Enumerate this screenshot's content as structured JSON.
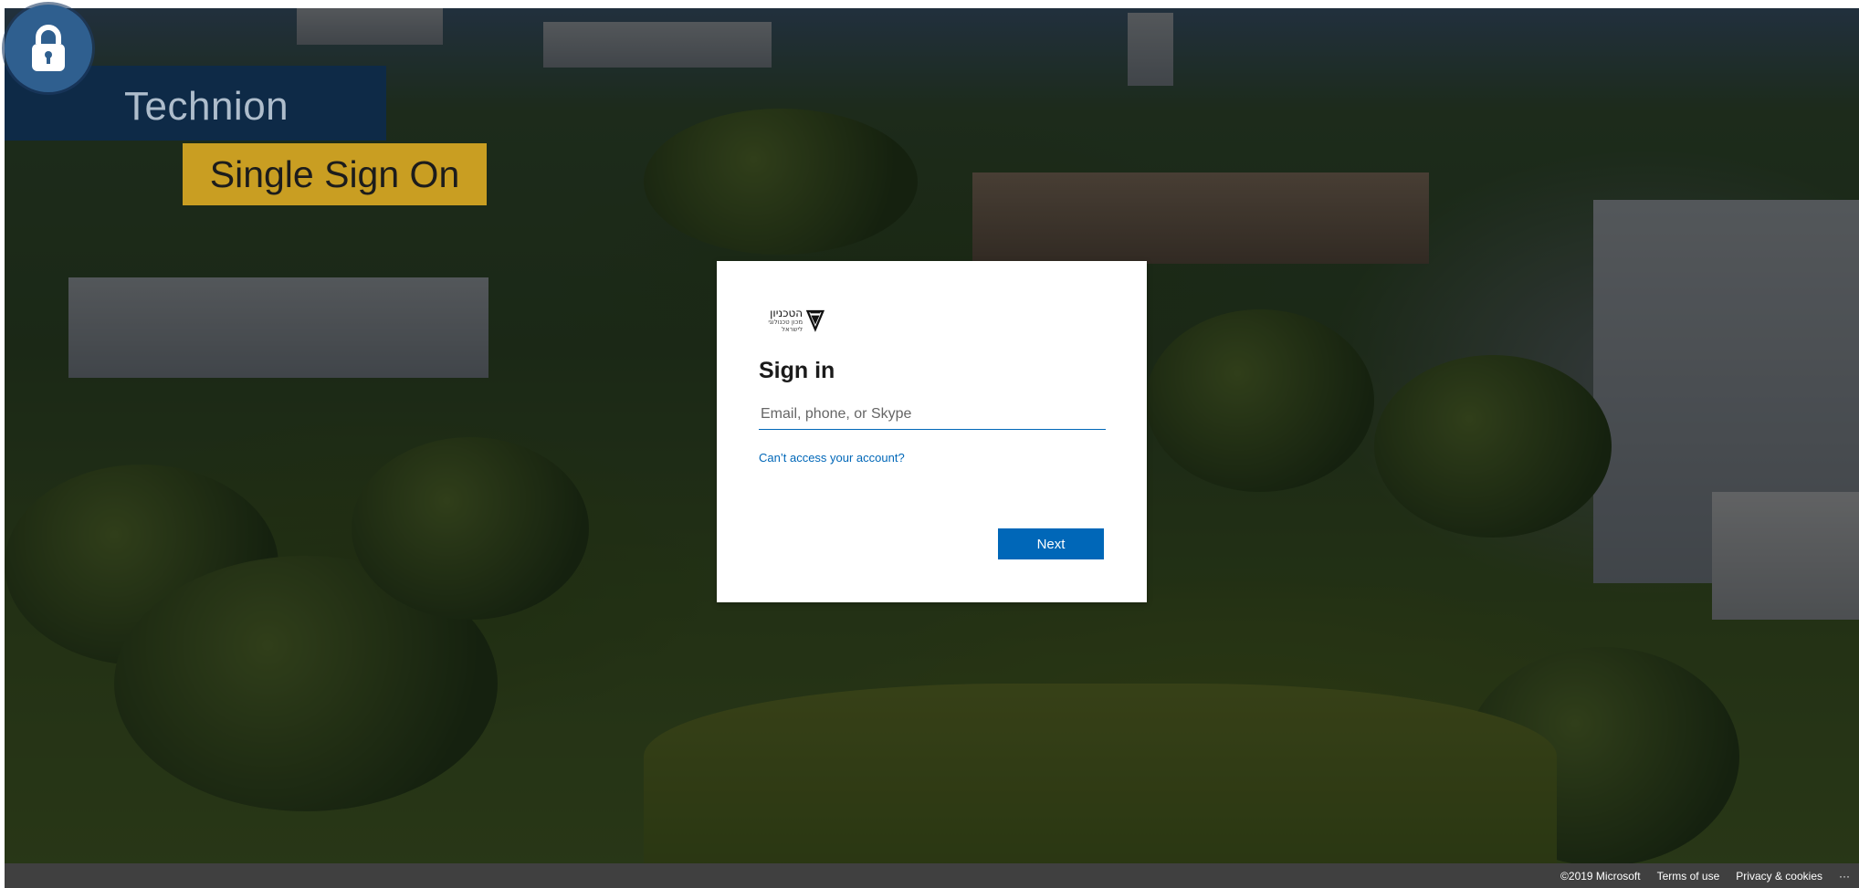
{
  "branding": {
    "name": "Technion",
    "tagline": "Single Sign On",
    "lock_icon": "lock-icon",
    "accent_blue": "#2f5f8f",
    "banner_navy": "#0e2a47",
    "banner_gold": "#c99e22"
  },
  "card": {
    "logo_hebrew_main": "הטכניון",
    "logo_hebrew_sub": "מכון טכנולוגי לישראל",
    "title": "Sign in",
    "email_placeholder": "Email, phone, or Skype",
    "cant_access_label": "Can’t access your account?",
    "next_label": "Next",
    "primary_color": "#0067b8"
  },
  "footer": {
    "copyright": "©2019 Microsoft",
    "terms_label": "Terms of use",
    "privacy_label": "Privacy & cookies",
    "more_label": "···"
  }
}
